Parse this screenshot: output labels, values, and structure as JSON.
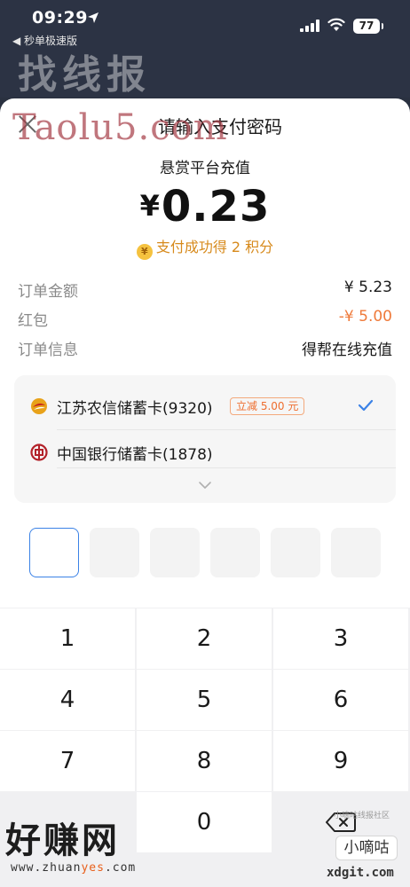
{
  "status_bar": {
    "time": "09:29",
    "back_app": "◀ 秒单极速版",
    "battery": "77"
  },
  "watermarks": {
    "top": "找线报",
    "middle": "Taolu5.com",
    "bottom_left_big": "好赚网",
    "bottom_left_small_pre": "www.zhuan",
    "bottom_left_small_hl": "yes",
    "bottom_left_small_post": ".com",
    "bottom_right_tag": "小嘀咕线报社区",
    "bottom_right_chip": "小嘀咕",
    "bottom_right_url": "xdgit.com"
  },
  "sheet": {
    "title": "请输入支付密码",
    "merchant": "悬赏平台充值",
    "currency": "¥",
    "amount": "0.23",
    "points_icon": "¥",
    "points_text": "支付成功得 2 积分"
  },
  "details": [
    {
      "label": "订单金额",
      "value": "¥ 5.23"
    },
    {
      "label": "红包",
      "value": "-¥ 5.00"
    },
    {
      "label": "订单信息",
      "value": "得帮在线充值"
    }
  ],
  "cards": [
    {
      "name": "江苏农信储蓄卡(9320)",
      "discount": "立减 5.00 元",
      "selected": true
    },
    {
      "name": "中国银行储蓄卡(1878)",
      "discount": "",
      "selected": false
    }
  ],
  "keypad": {
    "keys": [
      "1",
      "2",
      "3",
      "4",
      "5",
      "6",
      "7",
      "8",
      "9",
      "0"
    ]
  },
  "colors": {
    "accent": "#3b82e6",
    "discount": "#ee6d2e",
    "points": "#d78a1c",
    "red_value": "#ef7a3a"
  }
}
